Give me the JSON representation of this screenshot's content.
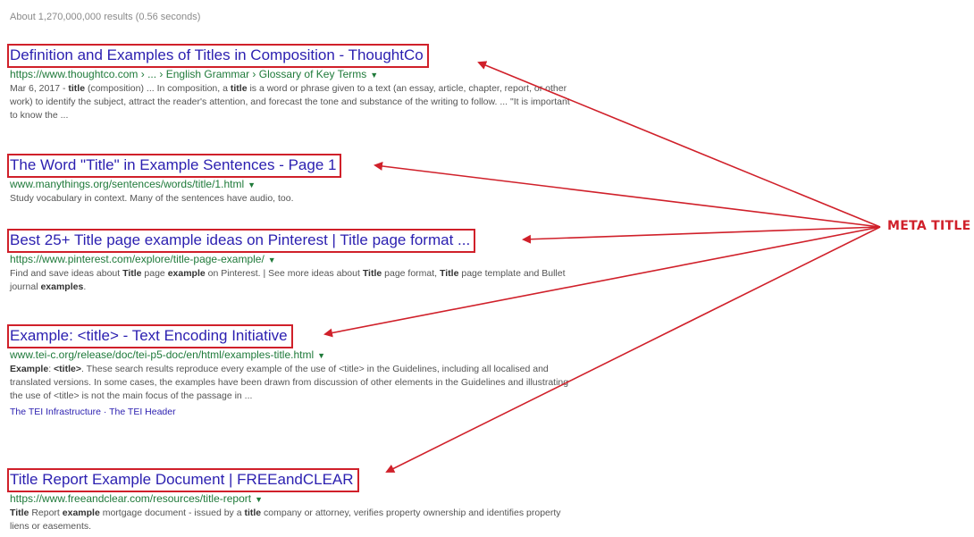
{
  "stats": "About 1,270,000,000 results (0.56 seconds)",
  "annotation_label": "META TITLE",
  "annotation_color": "#d0202a",
  "results": [
    {
      "title": "Definition and Examples of Titles in Composition - ThoughtCo",
      "url": "https://www.thoughtco.com › ... › English Grammar › Glossary of Key Terms",
      "snippet": [
        {
          "t": "Mar 6, 2017 - "
        },
        {
          "t": "title",
          "b": true
        },
        {
          "t": " (composition) ... In composition, a "
        },
        {
          "t": "title",
          "b": true
        },
        {
          "t": " is a word or phrase given to a text (an essay, article, chapter, report, or other work) to identify the subject, attract the reader's attention, and forecast the tone and substance of the writing to follow. ... \"It is important to know the ..."
        }
      ]
    },
    {
      "title": "The Word \"Title\" in Example Sentences - Page 1",
      "url": "www.manythings.org/sentences/words/title/1.html",
      "snippet": [
        {
          "t": "Study vocabulary in context. Many of the sentences have audio, too."
        }
      ]
    },
    {
      "title": "Best 25+ Title page example ideas on Pinterest | Title page format ...",
      "url": "https://www.pinterest.com/explore/title-page-example/",
      "snippet": [
        {
          "t": "Find and save ideas about "
        },
        {
          "t": "Title",
          "b": true
        },
        {
          "t": " page "
        },
        {
          "t": "example",
          "b": true
        },
        {
          "t": " on Pinterest. | See more ideas about "
        },
        {
          "t": "Title",
          "b": true
        },
        {
          "t": " page format, "
        },
        {
          "t": "Title",
          "b": true
        },
        {
          "t": " page template and Bullet journal "
        },
        {
          "t": "examples",
          "b": true
        },
        {
          "t": "."
        }
      ]
    },
    {
      "title": "Example: <title> - Text Encoding Initiative",
      "url": "www.tei-c.org/release/doc/tei-p5-doc/en/html/examples-title.html",
      "snippet": [
        {
          "t": "Example",
          "b": true
        },
        {
          "t": ": "
        },
        {
          "t": "<title>",
          "b": true
        },
        {
          "t": ". These search results reproduce every example of the use of <title> in the Guidelines, including all localised and translated versions. In some cases, the examples have been drawn from discussion of other elements in the Guidelines and illustrating the use of <title> is not the main focus of the passage in ..."
        }
      ],
      "sublinks": [
        "The TEI Infrastructure",
        "The TEI Header"
      ]
    },
    {
      "title": "Title Report Example Document | FREEandCLEAR",
      "url": "https://www.freeandclear.com/resources/title-report",
      "snippet": [
        {
          "t": "Title",
          "b": true
        },
        {
          "t": " Report "
        },
        {
          "t": "example",
          "b": true
        },
        {
          "t": " mortgage document - issued by a "
        },
        {
          "t": "title",
          "b": true
        },
        {
          "t": " company or attorney, verifies property ownership and identifies property liens or easements."
        }
      ]
    }
  ]
}
